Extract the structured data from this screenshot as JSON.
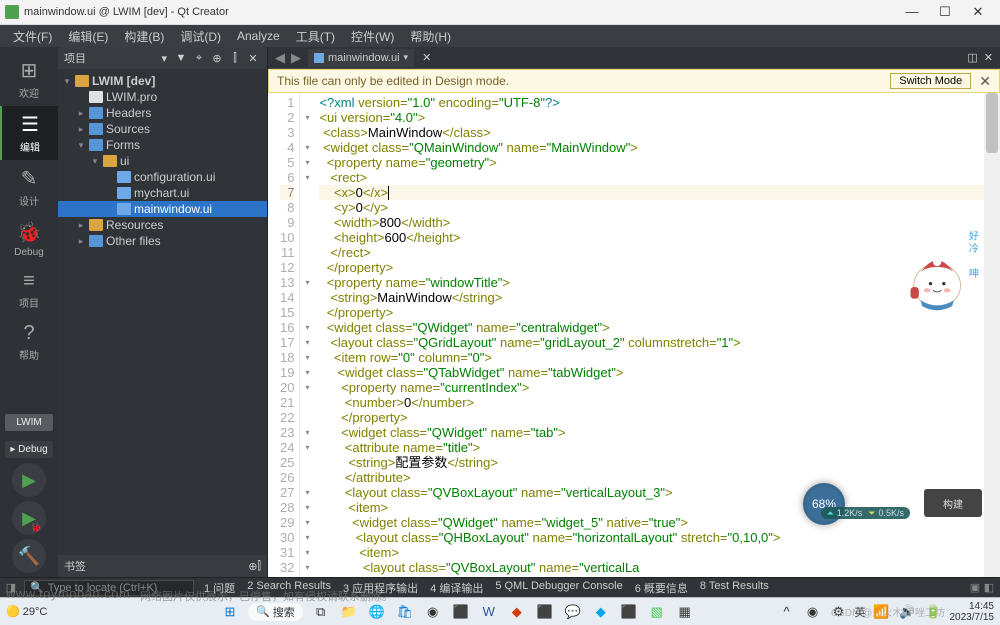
{
  "window": {
    "title": "mainwindow.ui @ LWIM [dev] - Qt Creator"
  },
  "menu": {
    "items": [
      "文件(F)",
      "编辑(E)",
      "构建(B)",
      "调试(D)",
      "Analyze",
      "工具(T)",
      "控件(W)",
      "帮助(H)"
    ]
  },
  "modes": {
    "items": [
      {
        "icon": "⊞",
        "label": "欢迎"
      },
      {
        "icon": "☰",
        "label": "编辑",
        "active": true
      },
      {
        "icon": "✎",
        "label": "设计"
      },
      {
        "icon": "🐞",
        "label": "Debug"
      },
      {
        "icon": "≡",
        "label": "项目"
      },
      {
        "icon": "?",
        "label": "帮助"
      }
    ],
    "kit": "LWIM",
    "debug_kit": "Debug"
  },
  "project_pane": {
    "title": "项目",
    "bookmarks": "书签",
    "tree": [
      {
        "depth": 0,
        "expand": "▾",
        "icon": "folder",
        "label": "LWIM [dev]",
        "bold": true
      },
      {
        "depth": 1,
        "expand": " ",
        "icon": "file",
        "label": "LWIM.pro"
      },
      {
        "depth": 1,
        "expand": "▸",
        "icon": "folder blue",
        "label": "Headers"
      },
      {
        "depth": 1,
        "expand": "▸",
        "icon": "folder blue",
        "label": "Sources"
      },
      {
        "depth": 1,
        "expand": "▾",
        "icon": "folder blue",
        "label": "Forms"
      },
      {
        "depth": 2,
        "expand": "▾",
        "icon": "folder",
        "label": "ui"
      },
      {
        "depth": 3,
        "expand": " ",
        "icon": "file ui",
        "label": "configuration.ui"
      },
      {
        "depth": 3,
        "expand": " ",
        "icon": "file ui",
        "label": "mychart.ui"
      },
      {
        "depth": 3,
        "expand": " ",
        "icon": "file ui",
        "label": "mainwindow.ui",
        "selected": true
      },
      {
        "depth": 1,
        "expand": "▸",
        "icon": "folder",
        "label": "Resources"
      },
      {
        "depth": 1,
        "expand": "▸",
        "icon": "folder blue",
        "label": "Other files"
      }
    ]
  },
  "editor": {
    "tab_name": "mainwindow.ui",
    "info_text": "This file can only be edited in Design mode.",
    "switch_label": "Switch Mode",
    "current_line": 7,
    "lines": [
      {
        "n": 1,
        "fold": "",
        "html": "<span class='tok-comment'>&lt;?xml</span> <span class='tok-attr'>version=</span><span class='tok-str'>\"1.0\"</span> <span class='tok-attr'>encoding=</span><span class='tok-str'>\"UTF-8\"</span><span class='tok-comment'>?&gt;</span>"
      },
      {
        "n": 2,
        "fold": "▾",
        "html": "<span class='tok-tag'>&lt;ui</span> <span class='tok-attr'>version=</span><span class='tok-str'>\"4.0\"</span><span class='tok-tag'>&gt;</span>"
      },
      {
        "n": 3,
        "fold": "",
        "html": " <span class='tok-tag'>&lt;class&gt;</span>MainWindow<span class='tok-tag'>&lt;/class&gt;</span>"
      },
      {
        "n": 4,
        "fold": "▾",
        "html": " <span class='tok-tag'>&lt;widget</span> <span class='tok-attr'>class=</span><span class='tok-str'>\"QMainWindow\"</span> <span class='tok-attr'>name=</span><span class='tok-str'>\"MainWindow\"</span><span class='tok-tag'>&gt;</span>"
      },
      {
        "n": 5,
        "fold": "▾",
        "html": "  <span class='tok-tag'>&lt;property</span> <span class='tok-attr'>name=</span><span class='tok-str'>\"geometry\"</span><span class='tok-tag'>&gt;</span>"
      },
      {
        "n": 6,
        "fold": "▾",
        "html": "   <span class='tok-tag'>&lt;rect&gt;</span>"
      },
      {
        "n": 7,
        "fold": "",
        "html": "    <span class='tok-tag'>&lt;x&gt;</span>0<span class='tok-tag'>&lt;/x&gt;</span><span class='cursor'></span>"
      },
      {
        "n": 8,
        "fold": "",
        "html": "    <span class='tok-tag'>&lt;y&gt;</span>0<span class='tok-tag'>&lt;/y&gt;</span>"
      },
      {
        "n": 9,
        "fold": "",
        "html": "    <span class='tok-tag'>&lt;width&gt;</span>800<span class='tok-tag'>&lt;/width&gt;</span>"
      },
      {
        "n": 10,
        "fold": "",
        "html": "    <span class='tok-tag'>&lt;height&gt;</span>600<span class='tok-tag'>&lt;/height&gt;</span>"
      },
      {
        "n": 11,
        "fold": "",
        "html": "   <span class='tok-tag'>&lt;/rect&gt;</span>"
      },
      {
        "n": 12,
        "fold": "",
        "html": "  <span class='tok-tag'>&lt;/property&gt;</span>"
      },
      {
        "n": 13,
        "fold": "▾",
        "html": "  <span class='tok-tag'>&lt;property</span> <span class='tok-attr'>name=</span><span class='tok-str'>\"windowTitle\"</span><span class='tok-tag'>&gt;</span>"
      },
      {
        "n": 14,
        "fold": "",
        "html": "   <span class='tok-tag'>&lt;string&gt;</span>MainWindow<span class='tok-tag'>&lt;/string&gt;</span>"
      },
      {
        "n": 15,
        "fold": "",
        "html": "  <span class='tok-tag'>&lt;/property&gt;</span>"
      },
      {
        "n": 16,
        "fold": "▾",
        "html": "  <span class='tok-tag'>&lt;widget</span> <span class='tok-attr'>class=</span><span class='tok-str'>\"QWidget\"</span> <span class='tok-attr'>name=</span><span class='tok-str'>\"centralwidget\"</span><span class='tok-tag'>&gt;</span>"
      },
      {
        "n": 17,
        "fold": "▾",
        "html": "   <span class='tok-tag'>&lt;layout</span> <span class='tok-attr'>class=</span><span class='tok-str'>\"QGridLayout\"</span> <span class='tok-attr'>name=</span><span class='tok-str'>\"gridLayout_2\"</span> <span class='tok-attr'>columnstretch=</span><span class='tok-str'>\"1\"</span><span class='tok-tag'>&gt;</span>"
      },
      {
        "n": 18,
        "fold": "▾",
        "html": "    <span class='tok-tag'>&lt;item</span> <span class='tok-attr'>row=</span><span class='tok-str'>\"0\"</span> <span class='tok-attr'>column=</span><span class='tok-str'>\"0\"</span><span class='tok-tag'>&gt;</span>"
      },
      {
        "n": 19,
        "fold": "▾",
        "html": "     <span class='tok-tag'>&lt;widget</span> <span class='tok-attr'>class=</span><span class='tok-str'>\"QTabWidget\"</span> <span class='tok-attr'>name=</span><span class='tok-str'>\"tabWidget\"</span><span class='tok-tag'>&gt;</span>"
      },
      {
        "n": 20,
        "fold": "▾",
        "html": "      <span class='tok-tag'>&lt;property</span> <span class='tok-attr'>name=</span><span class='tok-str'>\"currentIndex\"</span><span class='tok-tag'>&gt;</span>"
      },
      {
        "n": 21,
        "fold": "",
        "html": "       <span class='tok-tag'>&lt;number&gt;</span>0<span class='tok-tag'>&lt;/number&gt;</span>"
      },
      {
        "n": 22,
        "fold": "",
        "html": "      <span class='tok-tag'>&lt;/property&gt;</span>"
      },
      {
        "n": 23,
        "fold": "▾",
        "html": "      <span class='tok-tag'>&lt;widget</span> <span class='tok-attr'>class=</span><span class='tok-str'>\"QWidget\"</span> <span class='tok-attr'>name=</span><span class='tok-str'>\"tab\"</span><span class='tok-tag'>&gt;</span>"
      },
      {
        "n": 24,
        "fold": "▾",
        "html": "       <span class='tok-tag'>&lt;attribute</span> <span class='tok-attr'>name=</span><span class='tok-str'>\"title\"</span><span class='tok-tag'>&gt;</span>"
      },
      {
        "n": 25,
        "fold": "",
        "html": "        <span class='tok-tag'>&lt;string&gt;</span>配置参数<span class='tok-tag'>&lt;/string&gt;</span>"
      },
      {
        "n": 26,
        "fold": "",
        "html": "       <span class='tok-tag'>&lt;/attribute&gt;</span>"
      },
      {
        "n": 27,
        "fold": "▾",
        "html": "       <span class='tok-tag'>&lt;layout</span> <span class='tok-attr'>class=</span><span class='tok-str'>\"QVBoxLayout\"</span> <span class='tok-attr'>name=</span><span class='tok-str'>\"verticalLayout_3\"</span><span class='tok-tag'>&gt;</span>"
      },
      {
        "n": 28,
        "fold": "▾",
        "html": "        <span class='tok-tag'>&lt;item&gt;</span>"
      },
      {
        "n": 29,
        "fold": "▾",
        "html": "         <span class='tok-tag'>&lt;widget</span> <span class='tok-attr'>class=</span><span class='tok-str'>\"QWidget\"</span> <span class='tok-attr'>name=</span><span class='tok-str'>\"widget_5\"</span> <span class='tok-attr'>native=</span><span class='tok-str'>\"true\"</span><span class='tok-tag'>&gt;</span>"
      },
      {
        "n": 30,
        "fold": "▾",
        "html": "          <span class='tok-tag'>&lt;layout</span> <span class='tok-attr'>class=</span><span class='tok-str'>\"QHBoxLayout\"</span> <span class='tok-attr'>name=</span><span class='tok-str'>\"horizontalLayout\"</span> <span class='tok-attr'>stretch=</span><span class='tok-str'>\"0,10,0\"</span><span class='tok-tag'>&gt;</span>"
      },
      {
        "n": 31,
        "fold": "▾",
        "html": "           <span class='tok-tag'>&lt;item&gt;</span>"
      },
      {
        "n": 32,
        "fold": "▾",
        "html": "            <span class='tok-tag'>&lt;layout</span> <span class='tok-attr'>class=</span><span class='tok-str'>\"QVBoxLayout\"</span> <span class='tok-attr'>name=</span><span class='tok-str'>\"verticalLa</span>"
      }
    ]
  },
  "locator": {
    "placeholder": "Type to locate (Ctrl+K)"
  },
  "output_tabs": [
    "1 问题",
    "2 Search Results",
    "3 应用程序输出",
    "4 编译输出",
    "5 QML Debugger Console",
    "6 概要信息",
    "8 Test Results"
  ],
  "taskbar": {
    "temp": "29°C",
    "search": "搜索",
    "time": "14:45",
    "date": "2023/7/15"
  },
  "overlay": {
    "progress": "68%",
    "net_up": "1.2K/s",
    "net_down": "0.5K/s",
    "build": "构建",
    "mascot_text1": "好冷",
    "mascot_text2": "呻"
  },
  "watermark": {
    "site": "www.toymoban.com",
    "text": "网络图片仅供展示，已停售，如有侵权请联系删除。",
    "csdn": "CSDN @火火木/甲唑工坊"
  }
}
